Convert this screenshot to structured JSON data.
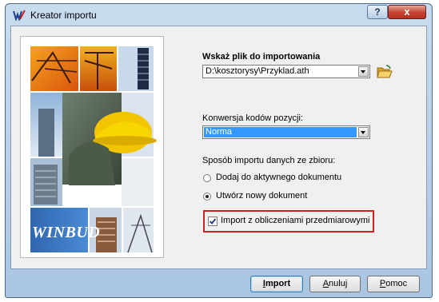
{
  "window": {
    "title": "Kreator importu",
    "help_label": "?",
    "close_label": "x"
  },
  "image": {
    "brand": "WINBUD"
  },
  "form": {
    "file_heading": "Wskaż plik do importowania",
    "file_value": "D:\\kosztorysy\\Przyklad.ath",
    "conversion_label": "Konwersja kodów pozycji:",
    "conversion_value": "Norma",
    "mode_label": "Sposób importu danych ze zbioru:",
    "mode_options": [
      {
        "label": "Dodaj do aktywnego dokumentu",
        "checked": false
      },
      {
        "label": "Utwórz nowy dokument",
        "checked": true
      }
    ],
    "checkbox_label": "Import z obliczeniami przedmiarowymi",
    "checkbox_checked": true
  },
  "buttons": {
    "import": {
      "pre": "",
      "accel": "I",
      "post": "mport"
    },
    "cancel": {
      "pre": "",
      "accel": "A",
      "post": "nuluj"
    },
    "help": {
      "pre": "",
      "accel": "P",
      "post": "omoc"
    }
  },
  "colors": {
    "selection": "#3399ff",
    "highlight": "#d22020",
    "close": "#c4432f"
  }
}
